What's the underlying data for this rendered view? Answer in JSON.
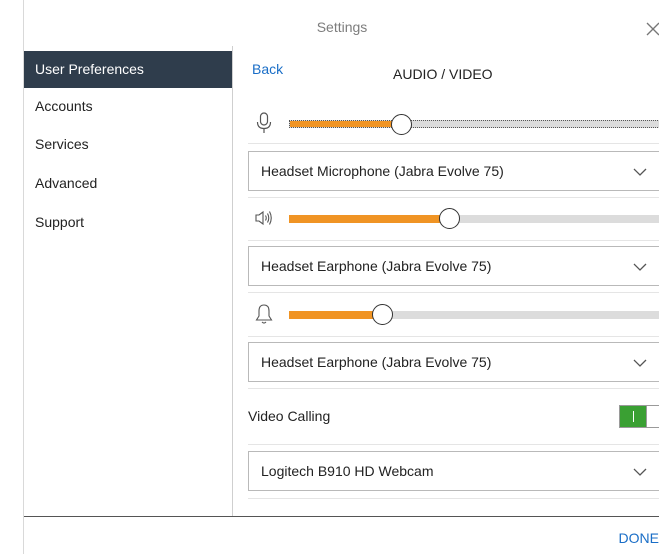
{
  "window": {
    "title": "Settings"
  },
  "sidebar": {
    "items": [
      {
        "label": "User Preferences",
        "active": true
      },
      {
        "label": "Accounts"
      },
      {
        "label": "Services"
      },
      {
        "label": "Advanced"
      },
      {
        "label": "Support"
      }
    ]
  },
  "main": {
    "back_label": "Back",
    "title": "AUDIO / VIDEO",
    "microphone": {
      "icon": "microphone-icon",
      "level": 0.3,
      "device": "Headset Microphone (Jabra Evolve 75)"
    },
    "speaker": {
      "icon": "speaker-icon",
      "level": 0.43,
      "device": "Headset Earphone (Jabra Evolve 75)"
    },
    "ringer": {
      "icon": "bell-icon",
      "level": 0.25,
      "device": "Headset Earphone (Jabra Evolve 75)"
    },
    "video_calling": {
      "label": "Video Calling",
      "enabled": true
    },
    "camera": {
      "device": "Logitech B910 HD Webcam"
    }
  },
  "footer": {
    "done_label": "DONE"
  },
  "colors": {
    "accent": "#f09424",
    "active_nav": "#2f3d4c",
    "link": "#1a6ec7",
    "toggle_on": "#3aa033"
  }
}
